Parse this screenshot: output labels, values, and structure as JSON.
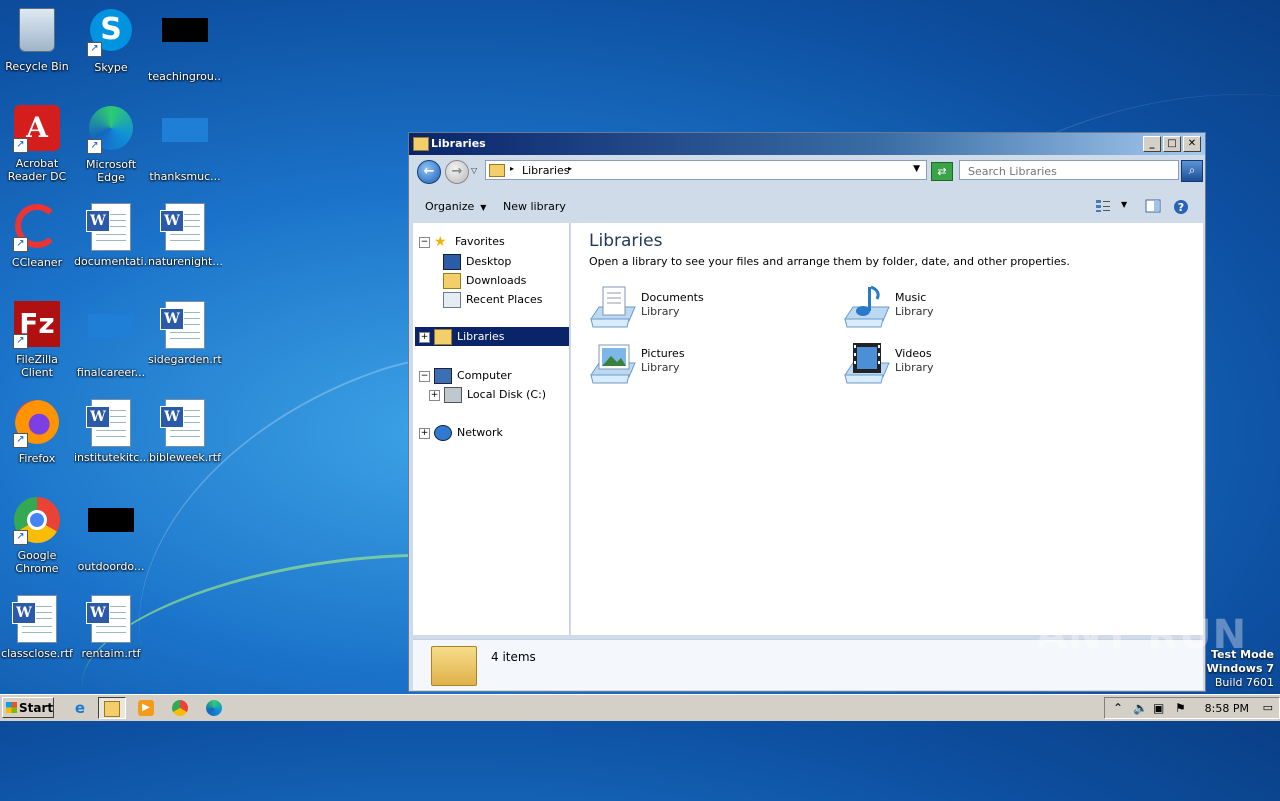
{
  "desktop": {
    "icons": [
      {
        "label": "Recycle Bin"
      },
      {
        "label": "Skype"
      },
      {
        "label": "teachingrou..."
      },
      {
        "label": "Acrobat Reader DC"
      },
      {
        "label": "Microsoft Edge"
      },
      {
        "label": "thanksmuc..."
      },
      {
        "label": "CCleaner"
      },
      {
        "label": "documentati..."
      },
      {
        "label": "naturenight..."
      },
      {
        "label": "FileZilla Client"
      },
      {
        "label": "finalcareer..."
      },
      {
        "label": "sidegarden.rtf"
      },
      {
        "label": "Firefox"
      },
      {
        "label": "institutekitc..."
      },
      {
        "label": "bibleweek.rtf"
      },
      {
        "label": "Google Chrome"
      },
      {
        "label": "outdoordo..."
      },
      {
        "label": "classclose.rtf"
      },
      {
        "label": "rentaim.rtf"
      }
    ]
  },
  "window": {
    "title": "Libraries",
    "address": {
      "path": "Libraries"
    },
    "search": {
      "placeholder": "Search Libraries"
    },
    "toolbar": {
      "organize": "Organize",
      "new_library": "New library"
    },
    "nav": {
      "favorites": "Favorites",
      "desktop": "Desktop",
      "downloads": "Downloads",
      "recent_places": "Recent Places",
      "libraries": "Libraries",
      "computer": "Computer",
      "local_disk": "Local Disk (C:)",
      "network": "Network"
    },
    "main": {
      "heading": "Libraries",
      "subtitle": "Open a library to see your files and arrange them by folder, date, and other properties.",
      "libraries": [
        {
          "name": "Documents",
          "type": "Library"
        },
        {
          "name": "Music",
          "type": "Library"
        },
        {
          "name": "Pictures",
          "type": "Library"
        },
        {
          "name": "Videos",
          "type": "Library"
        }
      ]
    },
    "details": {
      "count": "4 items"
    }
  },
  "taskbar": {
    "start": "Start",
    "clock": "8:58 PM"
  },
  "watermark": "ANY RUN",
  "test_mode": {
    "line1": "Test Mode",
    "line2": "Windows 7",
    "line3": "Build 7601"
  }
}
